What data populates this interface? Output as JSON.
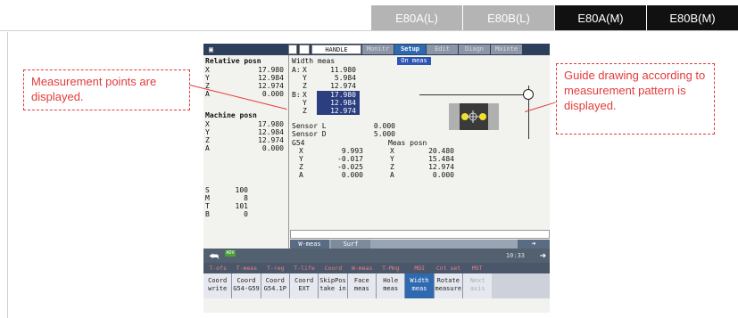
{
  "model_tabs": [
    {
      "label": "E80A(L)",
      "active": false
    },
    {
      "label": "E80B(L)",
      "active": false
    },
    {
      "label": "E80A(M)",
      "active": true
    },
    {
      "label": "E80B(M)",
      "active": true
    }
  ],
  "callouts": {
    "left": "Measurement points are displayed.",
    "right": "Guide drawing according to measurement pattern is displayed."
  },
  "screen": {
    "mode": "HANDLE",
    "tabs": [
      "Monitr",
      "Setup",
      "Edit",
      "Diagn",
      "Mainte"
    ],
    "selected_tab": "Setup",
    "relative_posn": {
      "title": "Relative posn",
      "rows": [
        {
          "axis": "X",
          "value": "17.980"
        },
        {
          "axis": "Y",
          "value": "12.984"
        },
        {
          "axis": "Z",
          "value": "12.974"
        },
        {
          "axis": "A",
          "value": "0.000"
        }
      ]
    },
    "machine_posn": {
      "title": "Machine posn",
      "rows": [
        {
          "axis": "X",
          "value": "17.980"
        },
        {
          "axis": "Y",
          "value": "12.984"
        },
        {
          "axis": "Z",
          "value": "12.974"
        },
        {
          "axis": "A",
          "value": "0.000"
        }
      ]
    },
    "spindle": [
      {
        "label": "S",
        "value": "100"
      },
      {
        "label": "M",
        "value": "8"
      },
      {
        "label": "T",
        "value": "101"
      },
      {
        "label": "B",
        "value": "0"
      }
    ],
    "width_meas": {
      "title": "Width meas",
      "status": "On meas",
      "a": {
        "label": "A:",
        "x": "11.980",
        "y": "5.984",
        "z": "12.974"
      },
      "b": {
        "label": "B:",
        "x": "17.980",
        "y": "12.984",
        "z": "12.974"
      }
    },
    "sensor": {
      "l_label": "Sensor L",
      "l_value": "0.000",
      "d_label": "Sensor D",
      "d_value": "5.000"
    },
    "g54": {
      "title": "G54",
      "rows": [
        {
          "axis": "X",
          "value": "9.993"
        },
        {
          "axis": "Y",
          "value": "-0.017"
        },
        {
          "axis": "Z",
          "value": "-0.025"
        },
        {
          "axis": "A",
          "value": "0.000"
        }
      ]
    },
    "meas_posn": {
      "title": "Meas posn",
      "rows": [
        {
          "axis": "X",
          "value": "20.480"
        },
        {
          "axis": "Y",
          "value": "15.484"
        },
        {
          "axis": "Z",
          "value": "12.974"
        },
        {
          "axis": "A",
          "value": "0.000"
        }
      ]
    },
    "subtabs": [
      "W-meas",
      "Surf"
    ],
    "clock": "10:33",
    "status": "ADV",
    "menu_top": [
      "T-ofs",
      "T-meas",
      "T-reg",
      "T-life",
      "Coord",
      "W-meas",
      "T-Mng",
      "MDI",
      "Cnt set",
      "MST"
    ],
    "menu_buttons": [
      {
        "l1": "Coord",
        "l2": "write",
        "state": "normal"
      },
      {
        "l1": "Coord",
        "l2": "G54-G59",
        "state": "normal"
      },
      {
        "l1": "Coord",
        "l2": "G54.1P",
        "state": "normal"
      },
      {
        "l1": "Coord",
        "l2": "EXT",
        "state": "normal"
      },
      {
        "l1": "SkipPos",
        "l2": "take in",
        "state": "normal"
      },
      {
        "l1": "Face",
        "l2": "meas",
        "state": "normal"
      },
      {
        "l1": "Hole",
        "l2": "meas",
        "state": "normal"
      },
      {
        "l1": "Width",
        "l2": "meas",
        "state": "selected"
      },
      {
        "l1": "Rotate",
        "l2": "measure",
        "state": "normal"
      },
      {
        "l1": "Next",
        "l2": "axis",
        "state": "dim"
      }
    ]
  }
}
